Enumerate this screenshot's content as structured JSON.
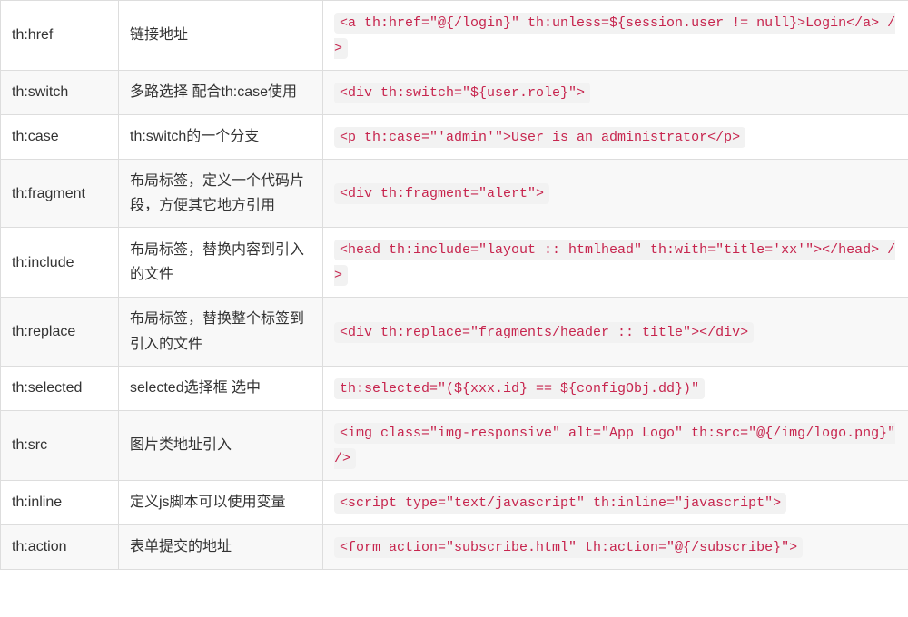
{
  "rows": [
    {
      "attr": "th:href",
      "desc": "链接地址",
      "code": "<a th:href=\"@{/login}\" th:unless=${session.user != null}>Login</a> />"
    },
    {
      "attr": "th:switch",
      "desc": "多路选择 配合th:case使用",
      "code": "<div th:switch=\"${user.role}\">"
    },
    {
      "attr": "th:case",
      "desc": "th:switch的一个分支",
      "code": "<p th:case=\"'admin'\">User is an administrator</p>"
    },
    {
      "attr": "th:fragment",
      "desc": "布局标签，定义一个代码片段，方便其它地方引用",
      "code": "<div th:fragment=\"alert\">"
    },
    {
      "attr": "th:include",
      "desc": "布局标签，替换内容到引入的文件",
      "code": "<head th:include=\"layout :: htmlhead\" th:with=\"title='xx'\"></head> />"
    },
    {
      "attr": "th:replace",
      "desc": "布局标签，替换整个标签到引入的文件",
      "code": "<div th:replace=\"fragments/header :: title\"></div>"
    },
    {
      "attr": "th:selected",
      "desc": "selected选择框 选中",
      "code": "th:selected=\"(${xxx.id} == ${configObj.dd})\""
    },
    {
      "attr": "th:src",
      "desc": "图片类地址引入",
      "code": "<img class=\"img-responsive\" alt=\"App Logo\" th:src=\"@{/img/logo.png}\" />"
    },
    {
      "attr": "th:inline",
      "desc": "定义js脚本可以使用变量",
      "code": "<script type=\"text/javascript\" th:inline=\"javascript\">"
    },
    {
      "attr": "th:action",
      "desc": "表单提交的地址",
      "code": "<form action=\"subscribe.html\" th:action=\"@{/subscribe}\">"
    }
  ]
}
